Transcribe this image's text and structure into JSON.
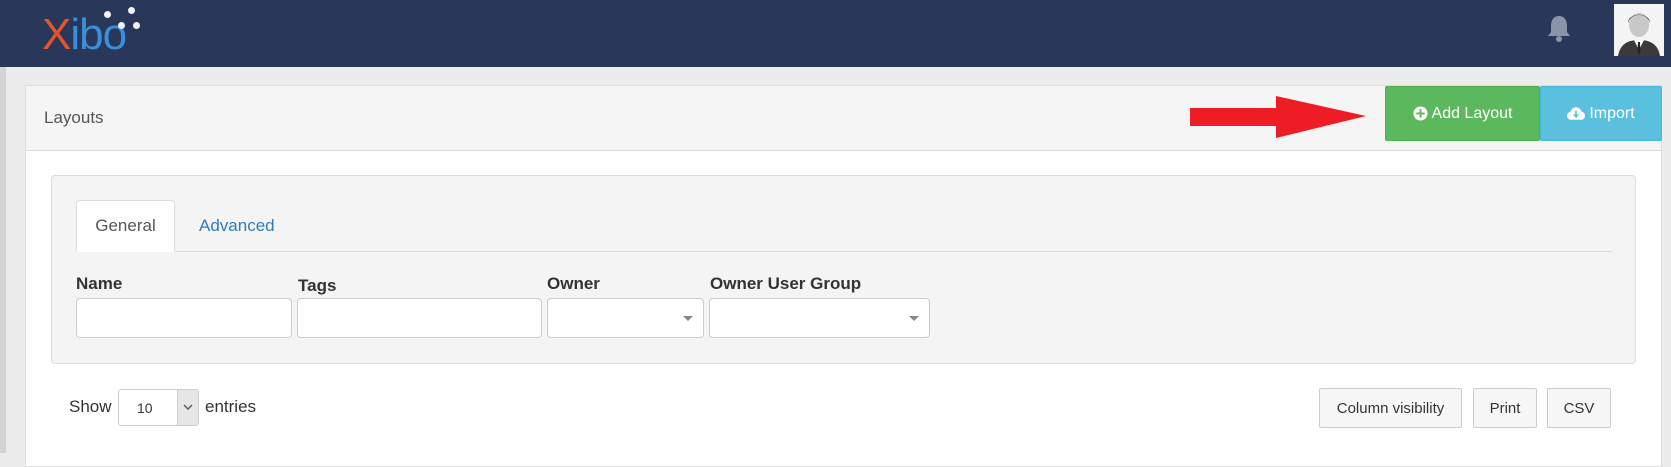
{
  "header": {
    "logo": "Xibo",
    "notifications_icon": "bell-icon",
    "user_icon": "user-avatar"
  },
  "page": {
    "title": "Layouts",
    "actions": {
      "add_layout": "Add Layout",
      "import": "Import"
    }
  },
  "filter": {
    "tabs": [
      {
        "label": "General",
        "active": true
      },
      {
        "label": "Advanced",
        "active": false
      }
    ],
    "fields": {
      "name": {
        "label": "Name",
        "value": ""
      },
      "tags": {
        "label": "Tags",
        "value": ""
      },
      "owner": {
        "label": "Owner",
        "value": ""
      },
      "owner_user_group": {
        "label": "Owner User Group",
        "value": ""
      }
    }
  },
  "table_controls": {
    "show_label": "Show",
    "page_length": "10",
    "entries_label": "entries",
    "buttons": {
      "column_visibility": "Column visibility",
      "print": "Print",
      "csv": "CSV"
    }
  },
  "colors": {
    "topbar": "#28375a",
    "logo_x": "#e2552c",
    "logo_rest": "#3a8fd9",
    "add_button": "#5cb85c",
    "import_button": "#5bc0de",
    "link": "#337ab7",
    "annotation_arrow": "#ee1c25"
  }
}
